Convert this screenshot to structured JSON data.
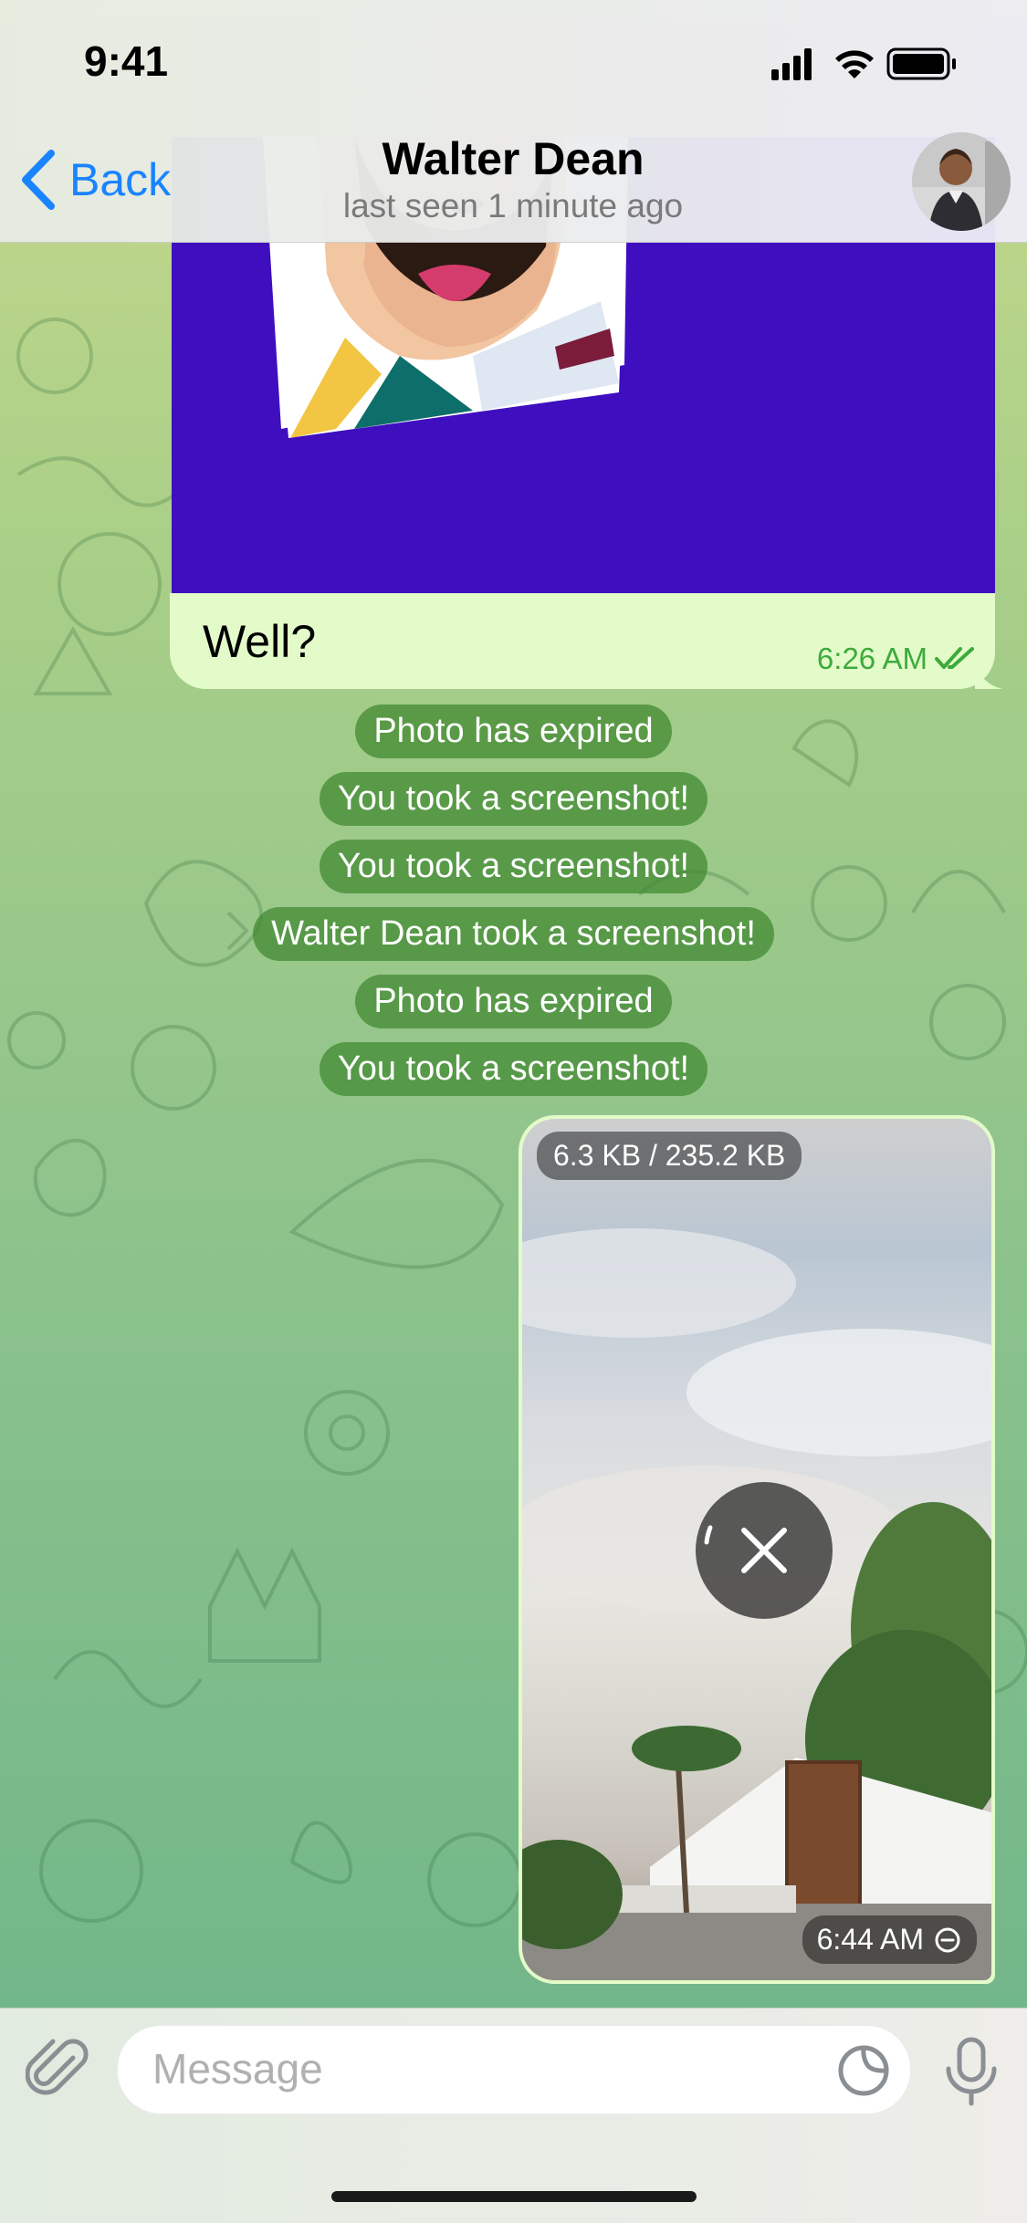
{
  "status_bar": {
    "time": "9:41"
  },
  "header": {
    "back_label": "Back",
    "title": "Walter Dean",
    "subtitle": "last seen 1 minute ago"
  },
  "messages": {
    "top_photo": {
      "caption": "Well?",
      "time": "6:26 AM",
      "status": "read-double-check-icon"
    },
    "service": [
      "Photo has expired",
      "You took a screenshot!",
      "You took a screenshot!",
      "Walter Dean took a screenshot!",
      "Photo has expired",
      "You took a screenshot!"
    ],
    "bottom_photo": {
      "download_progress": "6.3 KB / 235.2 KB",
      "time": "6:44 AM",
      "timer_icon": "self-destruct-timer-icon",
      "cancel_icon": "close-icon"
    }
  },
  "input": {
    "placeholder": "Message",
    "icons": [
      "paperclip-icon",
      "sticker-icon",
      "microphone-icon"
    ]
  },
  "colors": {
    "accent": "#1a84ff",
    "outgoing_bubble": "#e3fbc9",
    "check_green": "#3eaa3c",
    "service_bg": "#428a32"
  }
}
